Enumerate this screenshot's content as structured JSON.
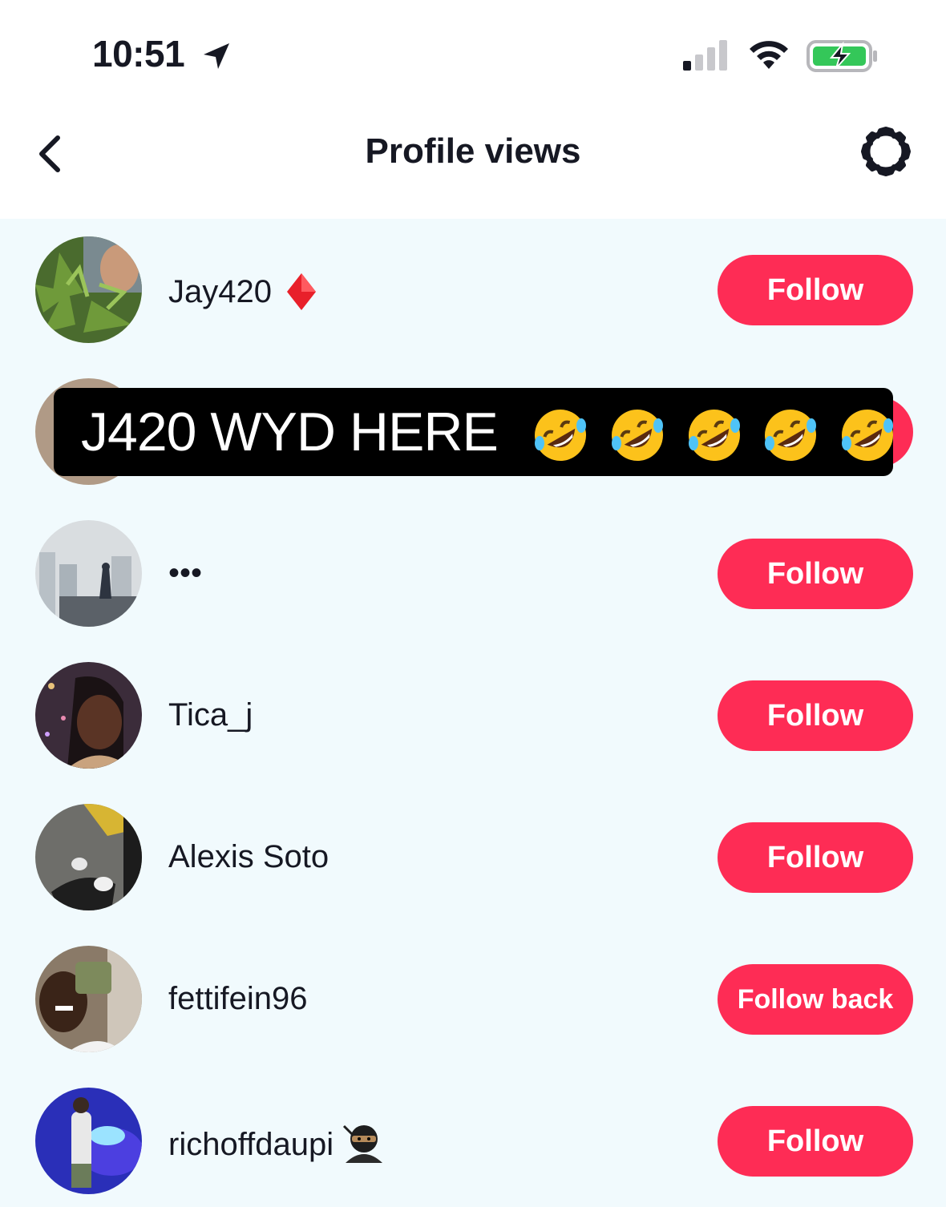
{
  "status_bar": {
    "time": "10:51",
    "battery_color": "#34c759"
  },
  "header": {
    "title": "Profile views"
  },
  "caption": {
    "text": "J420 WYD HERE",
    "emoji": "rolling-on-floor-laughing",
    "emoji_count": 5
  },
  "accent_color": "#fe2c55",
  "profiles": [
    {
      "username": "Jay420",
      "badge": "red-diamond",
      "button": "Follow"
    },
    {
      "username": "",
      "button": ""
    },
    {
      "username": "•••",
      "button": "Follow"
    },
    {
      "username": "Tica_j",
      "button": "Follow"
    },
    {
      "username": "Alexis Soto",
      "button": "Follow"
    },
    {
      "username": "fettifein96",
      "button": "Follow back"
    },
    {
      "username": "richoffdaupi",
      "badge": "ninja",
      "button": "Follow"
    }
  ]
}
